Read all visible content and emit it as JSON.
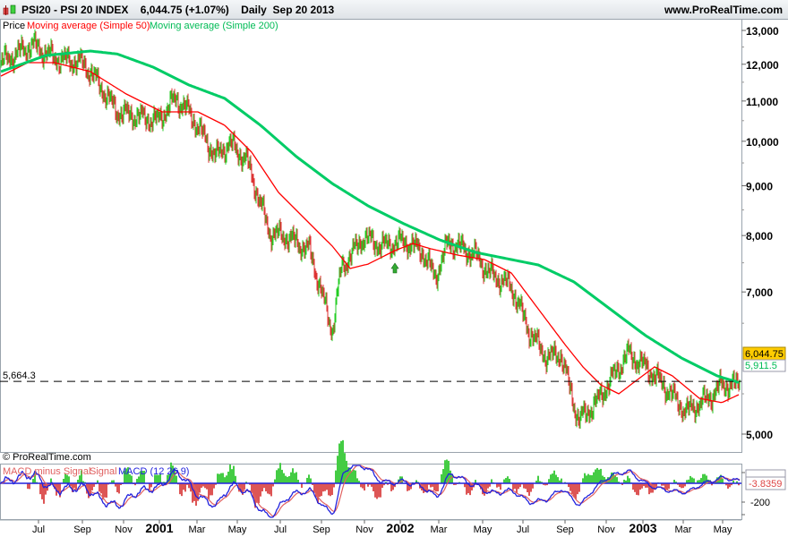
{
  "header": {
    "symbol": "PSI20 - PSI 20 INDEX",
    "last": "6,044.75 (+1.07%)",
    "period": "Daily",
    "date": "Sep 20 2013",
    "site": "www.ProRealTime.com"
  },
  "legend": {
    "price": "Price",
    "ma50": "Moving average (Simple 50)",
    "ma200": "Moving average (Simple 200)"
  },
  "copyright": "© ProRealTime.com",
  "macd_legend": {
    "hist": "MACD minus Signal",
    "signal": "Signal",
    "macd": "MACD (12 26 9)"
  },
  "colors": {
    "up": "#22cc22",
    "down": "#dd3333",
    "ma50": "#ff0000",
    "ma200": "#00cc66",
    "macd": "#2222dd",
    "signal": "#e06060"
  },
  "chart_data": {
    "type": "line",
    "title": "PSI20 - PSI 20 INDEX Daily",
    "scale": "log",
    "ylim": [
      4800,
      13300
    ],
    "y_ticks": [
      {
        "v": 13000,
        "l": "13,000"
      },
      {
        "v": 12000,
        "l": "12,000"
      },
      {
        "v": 11000,
        "l": "11,000"
      },
      {
        "v": 10000,
        "l": "10,000"
      },
      {
        "v": 9000,
        "l": "9,000"
      },
      {
        "v": 8000,
        "l": "8,000"
      },
      {
        "v": 7000,
        "l": "7,000"
      },
      {
        "v": 5000,
        "l": "5,000"
      }
    ],
    "x_ticks": [
      {
        "i": 42,
        "l": "Jul"
      },
      {
        "i": 91,
        "l": "Sep"
      },
      {
        "i": 137,
        "l": "Nov"
      },
      {
        "i": 177,
        "l": "2001",
        "b": true
      },
      {
        "i": 219,
        "l": "Mar"
      },
      {
        "i": 264,
        "l": "May"
      },
      {
        "i": 312,
        "l": "Jul"
      },
      {
        "i": 358,
        "l": "Sep"
      },
      {
        "i": 406,
        "l": "Nov"
      },
      {
        "i": 446,
        "l": "2002",
        "b": true
      },
      {
        "i": 489,
        "l": "Mar"
      },
      {
        "i": 538,
        "l": "May"
      },
      {
        "i": 583,
        "l": "Jul"
      },
      {
        "i": 630,
        "l": "Sep"
      },
      {
        "i": 676,
        "l": "Nov"
      },
      {
        "i": 717,
        "l": "2003",
        "b": true
      },
      {
        "i": 762,
        "l": "Mar"
      },
      {
        "i": 806,
        "l": "May"
      }
    ],
    "bars": 826,
    "price_keypoints": [
      [
        0,
        12046
      ],
      [
        35,
        12567
      ],
      [
        60,
        12173
      ],
      [
        90,
        12046
      ],
      [
        100,
        11792
      ],
      [
        130,
        10720
      ],
      [
        175,
        10496
      ],
      [
        195,
        11067
      ],
      [
        210,
        10720
      ],
      [
        240,
        9643
      ],
      [
        255,
        9954
      ],
      [
        275,
        9542
      ],
      [
        300,
        8054
      ],
      [
        320,
        7969
      ],
      [
        345,
        7719
      ],
      [
        370,
        6379
      ],
      [
        380,
        7400
      ],
      [
        405,
        7969
      ],
      [
        425,
        7803
      ],
      [
        450,
        7885
      ],
      [
        470,
        7719
      ],
      [
        485,
        7245
      ],
      [
        500,
        7885
      ],
      [
        530,
        7638
      ],
      [
        545,
        7322
      ],
      [
        570,
        7092
      ],
      [
        590,
        6379
      ],
      [
        610,
        5987
      ],
      [
        625,
        6050
      ],
      [
        645,
        5161
      ],
      [
        665,
        5386
      ],
      [
        700,
        6050
      ],
      [
        720,
        5862
      ],
      [
        740,
        5617
      ],
      [
        765,
        5272
      ],
      [
        790,
        5442
      ],
      [
        805,
        5617
      ],
      [
        826,
        5617
      ]
    ],
    "series": [
      {
        "name": "Moving average (Simple 50)",
        "points": [
          [
            0,
            11669
          ],
          [
            30,
            12046
          ],
          [
            60,
            12046
          ],
          [
            100,
            11792
          ],
          [
            140,
            11184
          ],
          [
            180,
            10720
          ],
          [
            220,
            10720
          ],
          [
            250,
            10384
          ],
          [
            280,
            9746
          ],
          [
            310,
            8860
          ],
          [
            340,
            8313
          ],
          [
            370,
            7803
          ],
          [
            390,
            7400
          ],
          [
            410,
            7477
          ],
          [
            440,
            7719
          ],
          [
            460,
            7852
          ],
          [
            480,
            7753
          ],
          [
            510,
            7638
          ],
          [
            540,
            7557
          ],
          [
            570,
            7322
          ],
          [
            600,
            6726
          ],
          [
            630,
            6180
          ],
          [
            650,
            5862
          ],
          [
            670,
            5617
          ],
          [
            690,
            5500
          ],
          [
            710,
            5679
          ],
          [
            730,
            5862
          ],
          [
            750,
            5738
          ],
          [
            780,
            5442
          ],
          [
            805,
            5386
          ],
          [
            826,
            5500
          ]
        ]
      },
      {
        "name": "Moving average (Simple 200)",
        "points": [
          [
            0,
            11792
          ],
          [
            50,
            12251
          ],
          [
            100,
            12381
          ],
          [
            130,
            12295
          ],
          [
            170,
            11918
          ],
          [
            210,
            11424
          ],
          [
            250,
            11067
          ],
          [
            290,
            10384
          ],
          [
            330,
            9643
          ],
          [
            370,
            9049
          ],
          [
            410,
            8583
          ],
          [
            450,
            8226
          ],
          [
            490,
            7918
          ],
          [
            530,
            7687
          ],
          [
            570,
            7557
          ],
          [
            600,
            7463
          ],
          [
            640,
            7168
          ],
          [
            680,
            6726
          ],
          [
            720,
            6313
          ],
          [
            760,
            5987
          ],
          [
            800,
            5738
          ],
          [
            826,
            5642
          ]
        ]
      }
    ],
    "hline": {
      "value": 5664.3,
      "label": "5,664.3"
    },
    "price_tags": [
      {
        "label": "6,044.75"
      },
      {
        "label": "5,911.5"
      }
    ],
    "macd": {
      "tick": "-200",
      "tag": "-3.8359"
    }
  }
}
